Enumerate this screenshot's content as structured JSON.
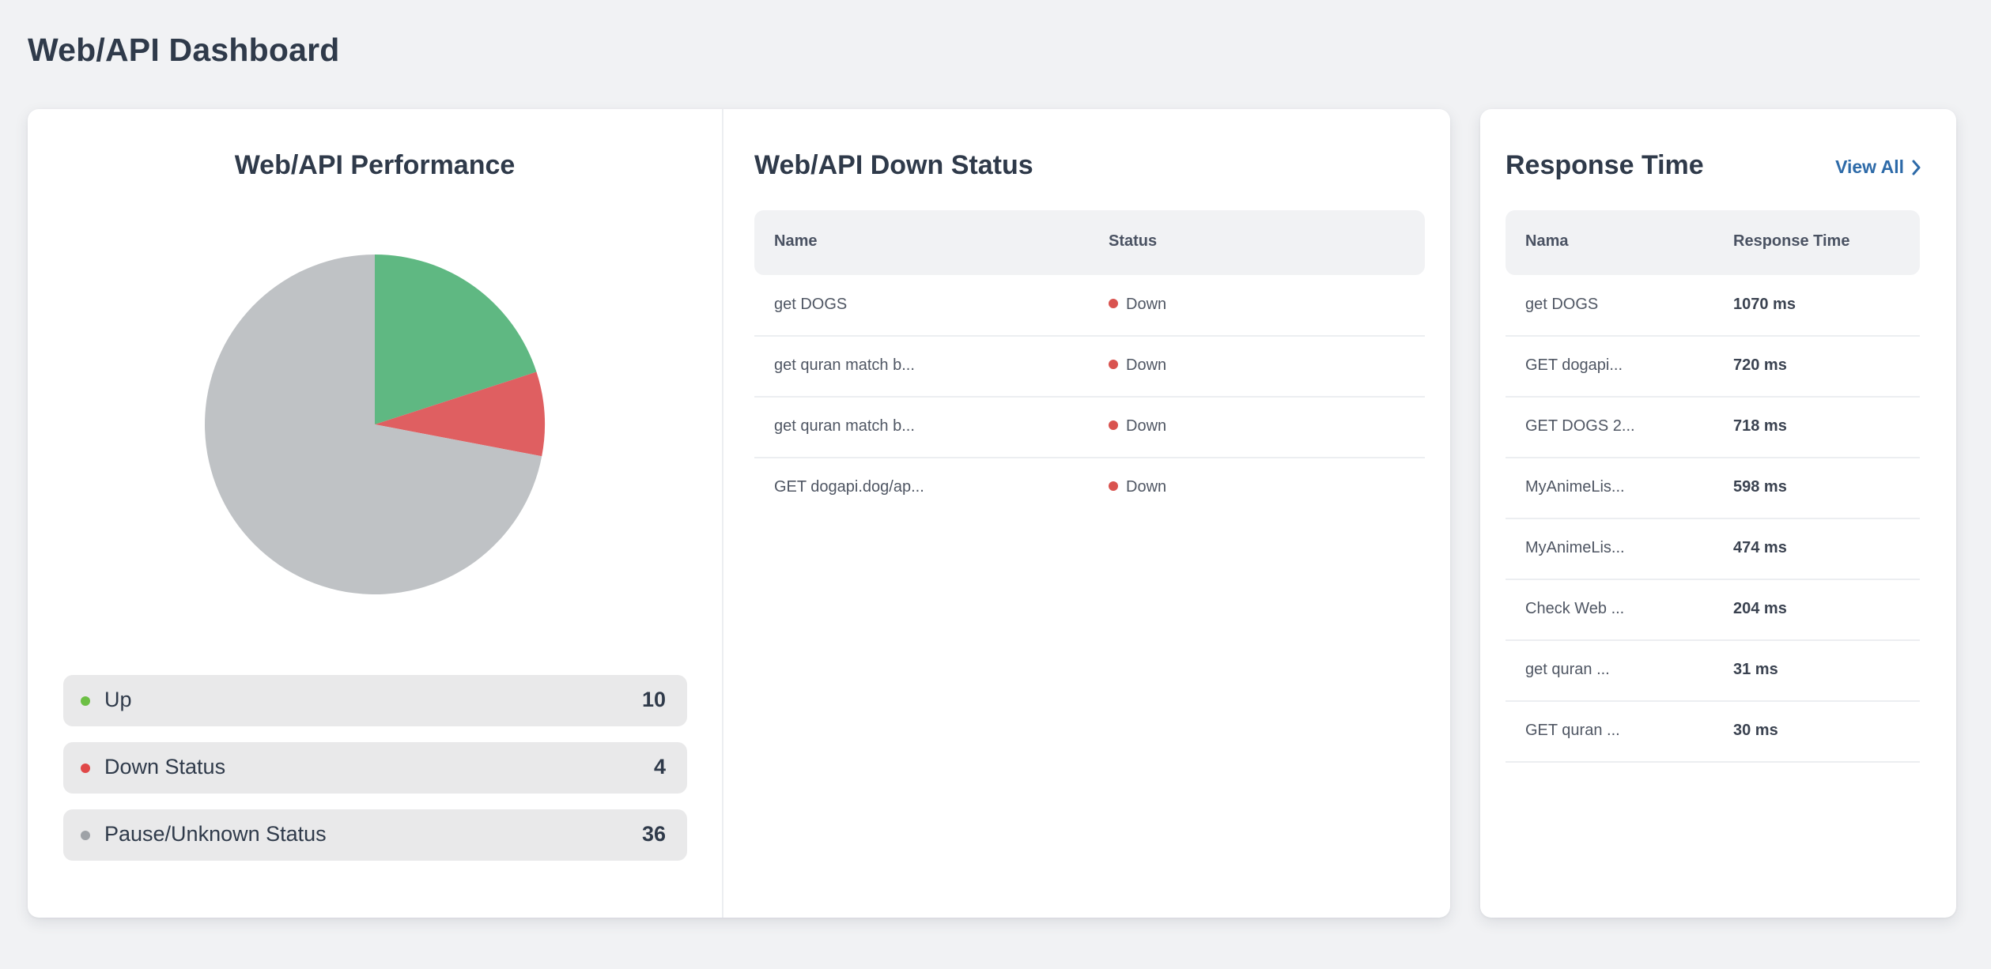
{
  "page": {
    "title": "Web/API Dashboard"
  },
  "performance": {
    "title": "Web/API Performance",
    "legend": [
      {
        "label": "Up",
        "count": "10",
        "color": "#6cbf44"
      },
      {
        "label": "Down Status",
        "count": "4",
        "color": "#e04848"
      },
      {
        "label": "Pause/Unknown Status",
        "count": "36",
        "color": "#9ea2a7"
      }
    ]
  },
  "chart_data": {
    "type": "pie",
    "title": "Web/API Performance",
    "categories": [
      "Up",
      "Down Status",
      "Pause/Unknown Status"
    ],
    "values": [
      10,
      4,
      36
    ],
    "colors": [
      "#5fb882",
      "#df5f61",
      "#bfc2c5"
    ],
    "legend": "bottom"
  },
  "down_status": {
    "title": "Web/API Down Status",
    "columns": [
      "Name",
      "Status"
    ],
    "status_color": "#d9534f",
    "rows": [
      {
        "name": "get DOGS",
        "status": "Down"
      },
      {
        "name": "get quran match b...",
        "status": "Down"
      },
      {
        "name": "get quran match b...",
        "status": "Down"
      },
      {
        "name": "GET dogapi.dog/ap...",
        "status": "Down"
      }
    ]
  },
  "response_time": {
    "title": "Response Time",
    "view_all_label": "View All",
    "view_all_icon": "chevron-right-icon",
    "columns": [
      "Nama",
      "Response Time"
    ],
    "rows": [
      {
        "name": "get DOGS",
        "time": "1070 ms"
      },
      {
        "name": "GET dogapi...",
        "time": "720 ms"
      },
      {
        "name": "GET DOGS 2...",
        "time": "718 ms"
      },
      {
        "name": "MyAnimeLis...",
        "time": "598 ms"
      },
      {
        "name": "MyAnimeLis...",
        "time": "474 ms"
      },
      {
        "name": "Check Web ...",
        "time": "204 ms"
      },
      {
        "name": "get quran ...",
        "time": "31 ms"
      },
      {
        "name": "GET quran ...",
        "time": "30 ms"
      }
    ]
  }
}
